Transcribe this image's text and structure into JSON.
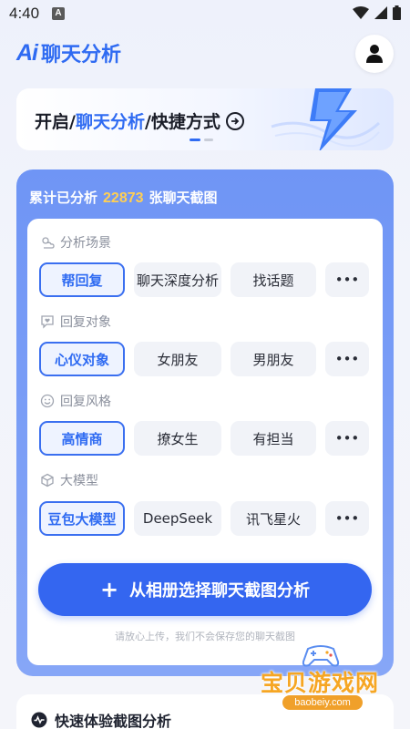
{
  "status_bar": {
    "time": "4:40",
    "badge": "A"
  },
  "header": {
    "logo_mark": "Ai",
    "title": "聊天分析"
  },
  "banner": {
    "prefix": "开启/",
    "highlight": "聊天分析",
    "suffix": "/快捷方式",
    "page_index": 1,
    "page_count": 2
  },
  "stats": {
    "prefix": "累计已分析",
    "count": "22873",
    "suffix": "张聊天截图"
  },
  "sections": [
    {
      "label": "分析场景",
      "icon": "cloud-sun-icon",
      "chips": [
        "帮回复",
        "聊天深度分析",
        "找话题"
      ],
      "selected": 0
    },
    {
      "label": "回复对象",
      "icon": "heart-chat-icon",
      "chips": [
        "心仪对象",
        "女朋友",
        "男朋友"
      ],
      "selected": 0
    },
    {
      "label": "回复风格",
      "icon": "smile-icon",
      "chips": [
        "高情商",
        "撩女生",
        "有担当"
      ],
      "selected": 0
    },
    {
      "label": "大模型",
      "icon": "cube-icon",
      "chips": [
        "豆包大模型",
        "DeepSeek",
        "讯飞星火"
      ],
      "selected": 0
    }
  ],
  "more_label": "•••",
  "cta": {
    "label": "从相册选择聊天截图分析"
  },
  "privacy_note": "请放心上传，我们不会保存您的聊天截图",
  "bottom": {
    "title": "快速体验截图分析"
  },
  "watermark": {
    "text": "宝贝游戏网",
    "domain": "baobeiy.com"
  },
  "colors": {
    "accent": "#2f6bf2",
    "card": "#7397f5",
    "count": "#ffcf53",
    "watermark": "#f6a623"
  }
}
